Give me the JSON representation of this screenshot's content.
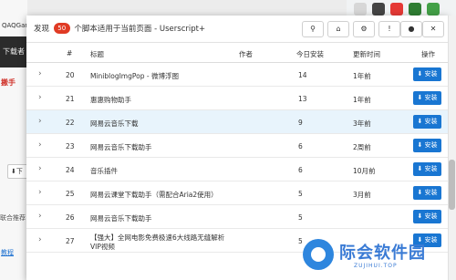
{
  "background": {
    "top_text": "QAQGar",
    "dark_bar_text": "下载者",
    "red_text": "搬手",
    "button_text": "⬇下",
    "small_text": "联合推荐",
    "link_text": "教程"
  },
  "popup": {
    "title_prefix": "发现",
    "count": "50",
    "title_suffix": "个脚本适用于当前页面 - Userscript+",
    "header_icons": [
      "search-icon",
      "home-icon",
      "settings-icon",
      "help-icon",
      "github-icon",
      "close-icon"
    ],
    "header_glyphs": [
      "⚲",
      "⌂",
      "⚙",
      "!",
      "●",
      "✕"
    ]
  },
  "table": {
    "columns": [
      "#",
      "标题",
      "作者",
      "今日安装",
      "更新时间",
      "操作"
    ],
    "install_label": "⬇ 安装",
    "rows": [
      {
        "num": "20",
        "title": "MiniblogImgPop - 微博浮图",
        "title2": "",
        "author": "",
        "today": "14",
        "updated": "1年前"
      },
      {
        "num": "21",
        "title": "惠惠购物助手",
        "title2": "",
        "author": "",
        "today": "13",
        "updated": "1年前"
      },
      {
        "num": "22",
        "title": "网易云音乐下载",
        "title2": "",
        "author": "",
        "today": "9",
        "updated": "3年前"
      },
      {
        "num": "23",
        "title": "网易云音乐下载助手",
        "title2": "",
        "author": "",
        "today": "6",
        "updated": "2周前"
      },
      {
        "num": "24",
        "title": "音乐插件",
        "title2": "",
        "author": "",
        "today": "6",
        "updated": "10月前"
      },
      {
        "num": "25",
        "title": "网易云课堂下载助手（需配合Aria2使用）",
        "title2": "",
        "author": "",
        "today": "5",
        "updated": "3月前"
      },
      {
        "num": "26",
        "title": "网易云音乐下载助手",
        "title2": "",
        "author": "",
        "today": "5",
        "updated": ""
      },
      {
        "num": "27",
        "title": "【强大】全网电影免费极速6大线路无缝解析",
        "title2": "VIP视频",
        "author": "",
        "today": "5",
        "updated": ""
      }
    ]
  },
  "watermark": {
    "text": "际会软件园",
    "sub": "ZUJIHUI.TOP"
  },
  "colors": {
    "install_button": "#1976d2",
    "badge": "#e03b24",
    "highlight_row": "#e8f4fc"
  }
}
